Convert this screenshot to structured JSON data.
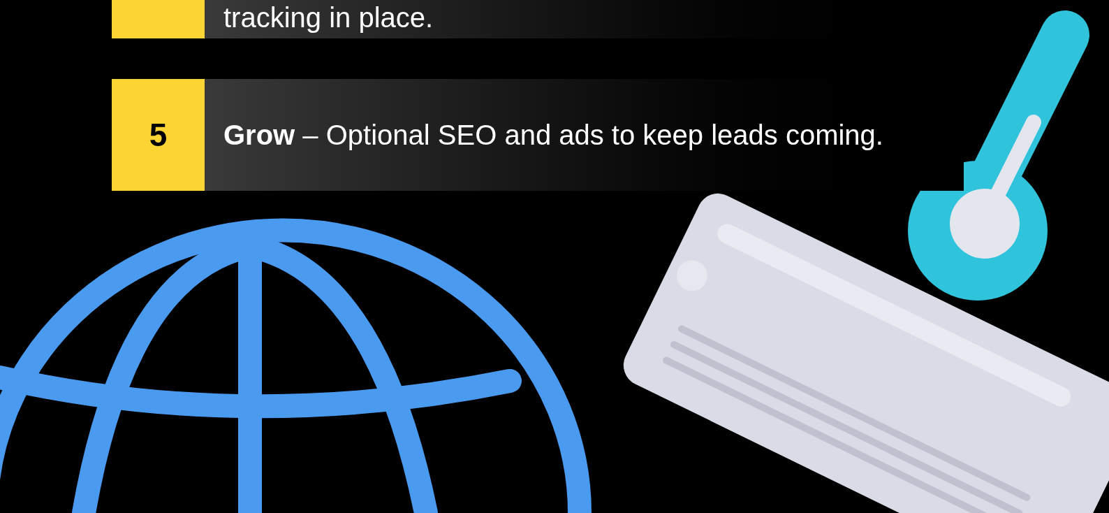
{
  "steps": [
    {
      "text": "tracking in place."
    },
    {
      "number": "5",
      "text": "**Grow** – Optional SEO and ads to keep leads coming."
    }
  ]
}
